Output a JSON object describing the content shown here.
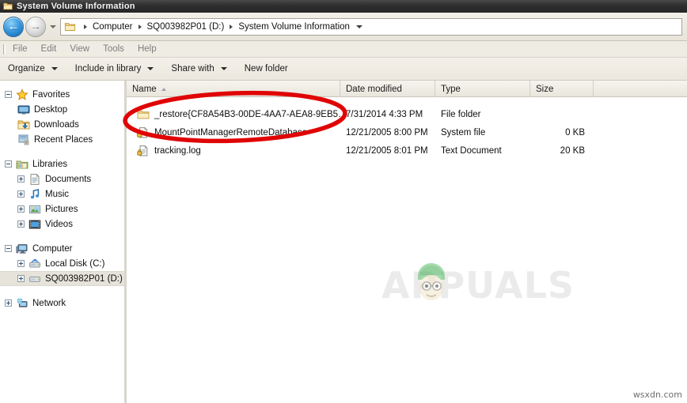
{
  "window": {
    "title": "System Volume Information",
    "title_icon": "folder-icon"
  },
  "address_bar": {
    "back_label": "←",
    "forward_label": "→",
    "folder_icon": "folder-icon",
    "breadcrumbs": [
      {
        "label": "Computer"
      },
      {
        "label": "SQ003982P01 (D:)"
      },
      {
        "label": "System Volume Information"
      }
    ]
  },
  "menu_bar": {
    "items": [
      {
        "label": "File"
      },
      {
        "label": "Edit"
      },
      {
        "label": "View"
      },
      {
        "label": "Tools"
      },
      {
        "label": "Help"
      }
    ]
  },
  "toolbar": {
    "items": [
      {
        "label": "Organize",
        "has_caret": true
      },
      {
        "label": "Include in library",
        "has_caret": true
      },
      {
        "label": "Share with",
        "has_caret": true
      },
      {
        "label": "New folder",
        "has_caret": false
      }
    ]
  },
  "sidebar": {
    "groups": [
      {
        "root": {
          "label": "Favorites",
          "icon": "star-icon",
          "expander": "minus"
        },
        "children": [
          {
            "label": "Desktop",
            "icon": "desktop-icon",
            "expander": "none"
          },
          {
            "label": "Downloads",
            "icon": "downloads-folder-icon",
            "expander": "none"
          },
          {
            "label": "Recent Places",
            "icon": "recent-places-icon",
            "expander": "none"
          }
        ]
      },
      {
        "root": {
          "label": "Libraries",
          "icon": "libraries-icon",
          "expander": "minus"
        },
        "children": [
          {
            "label": "Documents",
            "icon": "documents-library-icon",
            "expander": "plus"
          },
          {
            "label": "Music",
            "icon": "music-library-icon",
            "expander": "plus"
          },
          {
            "label": "Pictures",
            "icon": "pictures-library-icon",
            "expander": "plus"
          },
          {
            "label": "Videos",
            "icon": "videos-library-icon",
            "expander": "plus"
          }
        ]
      },
      {
        "root": {
          "label": "Computer",
          "icon": "computer-icon",
          "expander": "minus"
        },
        "children": [
          {
            "label": "Local Disk (C:)",
            "icon": "system-drive-icon",
            "expander": "plus",
            "selected": false
          },
          {
            "label": "SQ003982P01 (D:)",
            "icon": "drive-icon",
            "expander": "plus",
            "selected": true
          }
        ]
      },
      {
        "root": {
          "label": "Network",
          "icon": "network-icon",
          "expander": "plus"
        },
        "children": []
      }
    ]
  },
  "file_list": {
    "columns": [
      {
        "label": "Name",
        "sorted": true
      },
      {
        "label": "Date modified",
        "sorted": false
      },
      {
        "label": "Type",
        "sorted": false
      },
      {
        "label": "Size",
        "sorted": false
      }
    ],
    "rows": [
      {
        "name": "_restore{CF8A54B3-00DE-4AA7-AEA8-9EB5…",
        "date_modified": "7/31/2014 4:33 PM",
        "type": "File folder",
        "size": "",
        "icon": "folder-icon"
      },
      {
        "name": "MountPointManagerRemoteDatabase",
        "date_modified": "12/21/2005 8:00 PM",
        "type": "System file",
        "size": "0 KB",
        "icon": "locked-system-file-icon"
      },
      {
        "name": "tracking.log",
        "date_modified": "12/21/2005 8:01 PM",
        "type": "Text Document",
        "size": "20 KB",
        "icon": "locked-text-file-icon"
      }
    ]
  },
  "annotation": {
    "shape": "ellipse",
    "color": "#e00505",
    "target_row": "_restore{CF8A54B3-00DE-4AA7-AEA8-9EB5…"
  },
  "watermark": {
    "text": "APPUALS",
    "color": "#ebebeb"
  },
  "credit": {
    "text": "wsxdn.com"
  }
}
